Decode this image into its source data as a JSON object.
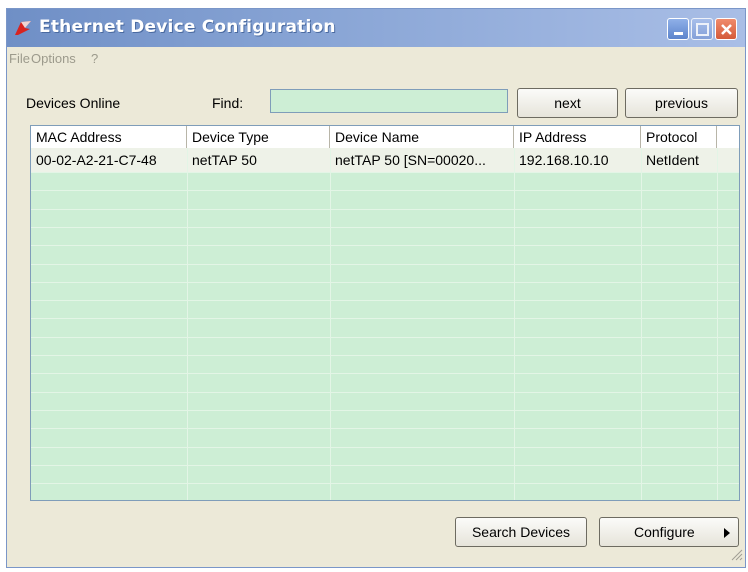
{
  "window": {
    "title": "Ethernet Device Configuration"
  },
  "menu": [
    "File",
    "Options",
    "?"
  ],
  "toolbar": {
    "devices_online": "Devices Online",
    "find_label": "Find:",
    "find_value": "",
    "next": "next",
    "previous": "previous"
  },
  "grid": {
    "columns": [
      "MAC Address",
      "Device Type",
      "Device Name",
      "IP Address",
      "Protocol"
    ],
    "rows": [
      [
        "00-02-A2-21-C7-48",
        "netTAP 50",
        "netTAP 50 [SN=00020...",
        "192.168.10.10",
        "NetIdent"
      ]
    ]
  },
  "footer": {
    "search": "Search Devices",
    "configure": "Configure"
  },
  "colors": {
    "accent": "#cdeed5",
    "titlebar": "#7d9bd0",
    "close": "#d45a3a"
  },
  "icons": [
    "app-flag-icon",
    "minimize-icon",
    "maximize-icon",
    "close-icon",
    "dropdown-arrow-icon",
    "resize-grip-icon"
  ]
}
